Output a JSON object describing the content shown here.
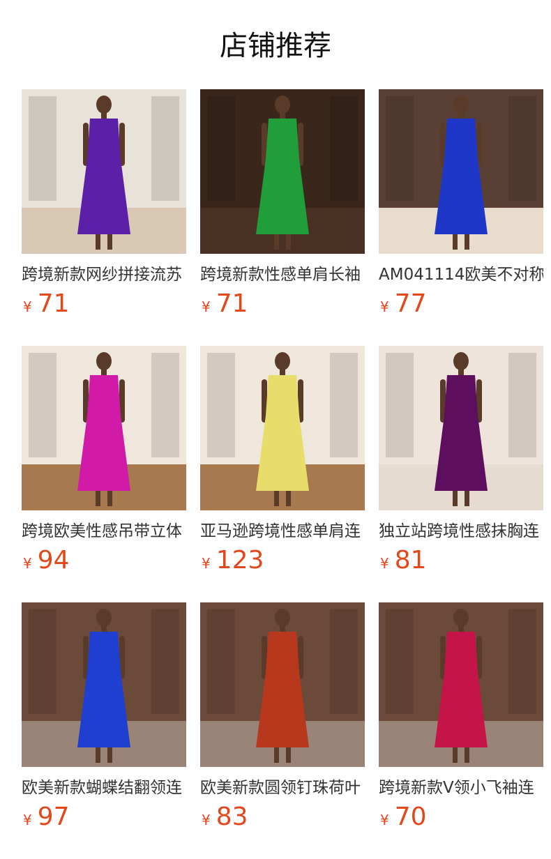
{
  "header": {
    "title": "店铺推荐"
  },
  "products": [
    {
      "title": "跨境新款网纱拼接流苏",
      "currency": "¥",
      "price": "71",
      "dress_color": "#5b1fa8",
      "bg_color": "#e9e2d8",
      "floor_color": "#d9c9b4",
      "skin": "#5a3a28",
      "photo": "woman-in-purple-fringe-dress"
    },
    {
      "title": "跨境新款性感单肩长袖",
      "currency": "¥",
      "price": "71",
      "dress_color": "#1f9e3a",
      "bg_color": "#3a261b",
      "floor_color": "#4a3022",
      "skin": "#5a3a28",
      "photo": "woman-in-green-one-shoulder-fringe-dress"
    },
    {
      "title": "AM041114欧美不对称",
      "currency": "¥",
      "price": "77",
      "dress_color": "#1f37c8",
      "bg_color": "#5a4034",
      "floor_color": "#e8dccc",
      "skin": "#5a3a28",
      "photo": "woman-in-blue-fringe-dress-on-stairs"
    },
    {
      "title": "跨境欧美性感吊带立体",
      "currency": "¥",
      "price": "94",
      "dress_color": "#d11aa8",
      "bg_color": "#efe6dc",
      "floor_color": "#a8784e",
      "skin": "#5a3a28",
      "photo": "woman-in-magenta-strap-dress"
    },
    {
      "title": "亚马逊跨境性感单肩连",
      "currency": "¥",
      "price": "123",
      "dress_color": "#e8dc6a",
      "bg_color": "#efe6dc",
      "floor_color": "#a8784e",
      "skin": "#5a3a28",
      "photo": "woman-in-yellow-pleated-dress"
    },
    {
      "title": "独立站跨境性感抹胸连",
      "currency": "¥",
      "price": "81",
      "dress_color": "#5e0e5e",
      "bg_color": "#efe4db",
      "floor_color": "#e6dbd0",
      "skin": "#5a3a28",
      "photo": "woman-in-plum-off-shoulder-dress"
    },
    {
      "title": "欧美新款蝴蝶结翻领连",
      "currency": "¥",
      "price": "97",
      "dress_color": "#1f3fd0",
      "bg_color": "#6b4a3a",
      "floor_color": "#9a8478",
      "skin": "#5a3a28",
      "photo": "woman-in-blue-sequin-dress"
    },
    {
      "title": "欧美新款圆领钉珠荷叶",
      "currency": "¥",
      "price": "83",
      "dress_color": "#b8381e",
      "bg_color": "#6b4a3a",
      "floor_color": "#9a8478",
      "skin": "#5a3a28",
      "photo": "woman-in-rust-beaded-dress"
    },
    {
      "title": "跨境新款V领小飞袖连",
      "currency": "¥",
      "price": "70",
      "dress_color": "#c41448",
      "bg_color": "#6b4a3a",
      "floor_color": "#9a8478",
      "skin": "#5a3a28",
      "photo": "woman-in-red-flutter-sleeve-dress"
    }
  ]
}
